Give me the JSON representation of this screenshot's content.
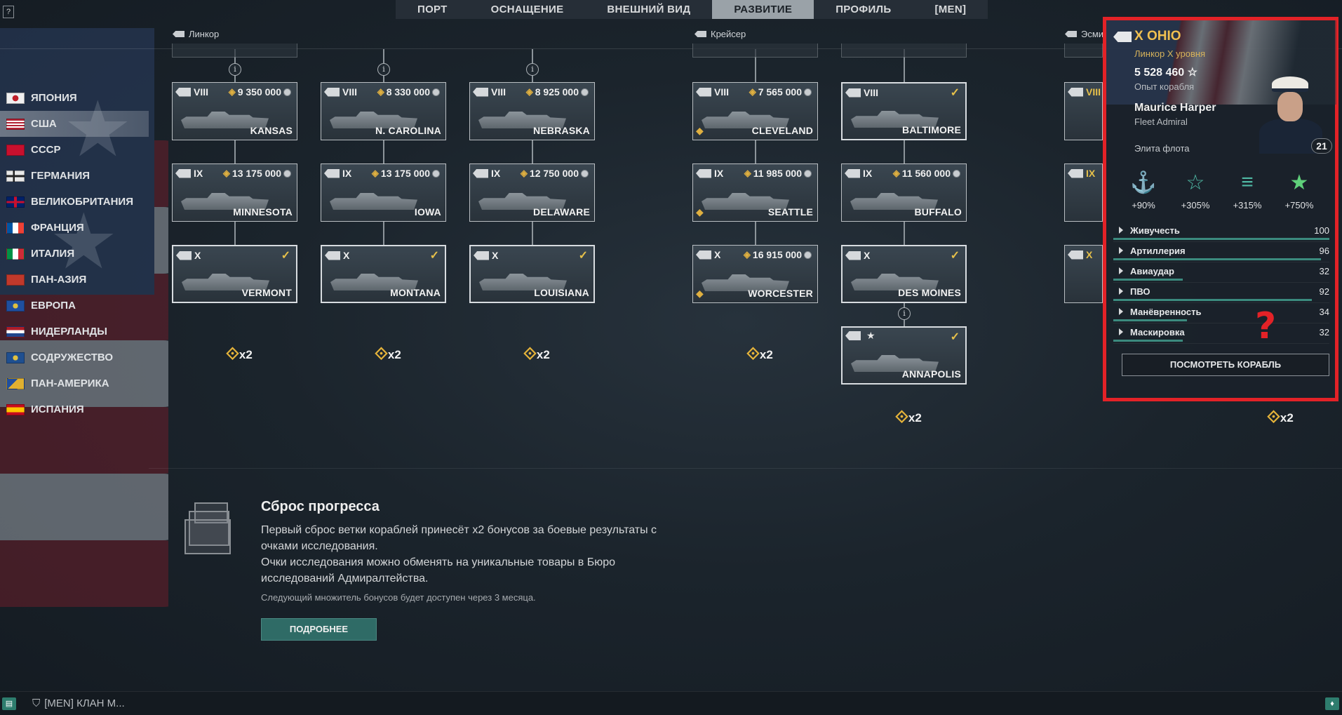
{
  "topnav": {
    "help": "?",
    "tabs": [
      "ПОРТ",
      "ОСНАЩЕНИЕ",
      "ВНЕШНИЙ ВИД",
      "РАЗВИТИЕ",
      "ПРОФИЛЬ",
      "[MEN]"
    ],
    "active": "РАЗВИТИЕ"
  },
  "class_headers": {
    "battleship": "Линкор",
    "cruiser": "Крейсер",
    "destroyer": "Эсми"
  },
  "nations": [
    {
      "label": "ЯПОНИЯ",
      "active": false
    },
    {
      "label": "США",
      "active": true
    },
    {
      "label": "СССР",
      "active": false
    },
    {
      "label": "ГЕРМАНИЯ",
      "active": false
    },
    {
      "label": "ВЕЛИКОБРИТАНИЯ",
      "active": false
    },
    {
      "label": "ФРАНЦИЯ",
      "active": false
    },
    {
      "label": "ИТАЛИЯ",
      "active": false
    },
    {
      "label": "ПАН-АЗИЯ",
      "active": false
    },
    {
      "label": "ЕВРОПА",
      "active": false
    },
    {
      "label": "НИДЕРЛАНДЫ",
      "active": false
    },
    {
      "label": "СОДРУЖЕСТВО",
      "active": false
    },
    {
      "label": "ПАН-АМЕРИКА",
      "active": false
    },
    {
      "label": "ИСПАНИЯ",
      "active": false
    }
  ],
  "ships": {
    "kansas": {
      "tier": "VIII",
      "price": "9 350 000",
      "name": "KANSAS"
    },
    "ncarolina": {
      "tier": "VIII",
      "price": "8 330 000",
      "name": "N. CAROLINA"
    },
    "nebraska": {
      "tier": "VIII",
      "price": "8 925 000",
      "name": "NEBRASKA"
    },
    "cleveland": {
      "tier": "VIII",
      "price": "7 565 000",
      "name": "CLEVELAND"
    },
    "baltimore": {
      "tier": "VIII",
      "price": "",
      "name": "BALTIMORE"
    },
    "minnesota": {
      "tier": "IX",
      "price": "13 175 000",
      "name": "MINNESOTA"
    },
    "iowa": {
      "tier": "IX",
      "price": "13 175 000",
      "name": "IOWA"
    },
    "delaware": {
      "tier": "IX",
      "price": "12 750 000",
      "name": "DELAWARE"
    },
    "seattle": {
      "tier": "IX",
      "price": "11 985 000",
      "name": "SEATTLE"
    },
    "buffalo": {
      "tier": "IX",
      "price": "11 560 000",
      "name": "BUFFALO"
    },
    "vermont": {
      "tier": "X",
      "price": "",
      "name": "VERMONT"
    },
    "montana": {
      "tier": "X",
      "price": "",
      "name": "MONTANA"
    },
    "louisiana": {
      "tier": "X",
      "price": "",
      "name": "LOUISIANA"
    },
    "worcester": {
      "tier": "X",
      "price": "16 915 000",
      "name": "WORCESTER"
    },
    "desmoines": {
      "tier": "X",
      "price": "",
      "name": "DES MOINES"
    },
    "annapolis": {
      "tier": "",
      "price": "",
      "name": "ANNAPOLIS"
    },
    "col6": {
      "tier8": "VIII",
      "tier9": "IX",
      "tier10": "X"
    }
  },
  "multiplier": "x2",
  "panel": {
    "title": "X OHIO",
    "subtitle": "Линкор X уровня",
    "xp": "5 528 460",
    "xp_label": "Опыт корабля",
    "commander": "Maurice Harper",
    "rank": "Fleet Admiral",
    "elite": "Элита флота",
    "level": "21",
    "bonuses": [
      "+90%",
      "+305%",
      "+315%",
      "+750%"
    ],
    "stats": [
      {
        "label": "Живучесть",
        "value": "100"
      },
      {
        "label": "Артиллерия",
        "value": "96"
      },
      {
        "label": "Авиаудар",
        "value": "32"
      },
      {
        "label": "ПВО",
        "value": "92"
      },
      {
        "label": "Манёвренность",
        "value": "34"
      },
      {
        "label": "Маскировка",
        "value": "32"
      }
    ],
    "view_button": "ПОСМОТРЕТЬ КОРАБЛЬ",
    "annotation": "?"
  },
  "reset": {
    "title": "Сброс прогресса",
    "text1": "Первый сброс ветки кораблей принесёт x2 бонусов за боевые результаты с очками исследования.",
    "text2": "Очки исследования можно обменять на уникальные товары в Бюро исследований Адмиралтейства.",
    "note": "Следующий множитель бонусов будет доступен через 3 месяца.",
    "button": "ПОДРОБНЕЕ"
  },
  "bottombar": {
    "clan": "[MEN] КЛАН М..."
  },
  "colors": {
    "accent": "#e6b43a",
    "highlight": "#e32227",
    "button": "#2f6b66"
  }
}
